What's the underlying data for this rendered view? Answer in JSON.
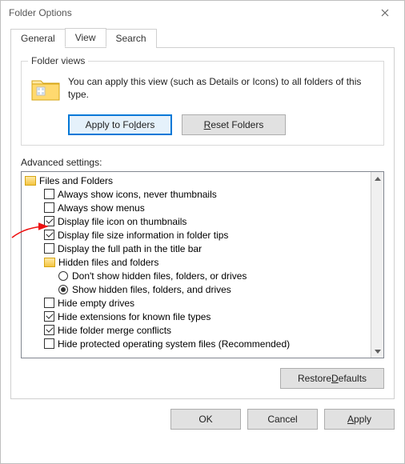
{
  "window": {
    "title": "Folder Options"
  },
  "tabs": {
    "general": "General",
    "view": "View",
    "search": "Search"
  },
  "folderViews": {
    "groupLabel": "Folder views",
    "text": "You can apply this view (such as Details or Icons) to all folders of this type.",
    "applyBtn_pre": "Apply to Fo",
    "applyBtn_u": "l",
    "applyBtn_post": "ders",
    "resetBtn_pre": "",
    "resetBtn_u": "R",
    "resetBtn_post": "eset Folders"
  },
  "advancedLabel": "Advanced settings:",
  "tree": {
    "root": "Files and Folders",
    "i0": "Always show icons, never thumbnails",
    "i1": "Always show menus",
    "i2": "Display file icon on thumbnails",
    "i3": "Display file size information in folder tips",
    "i4": "Display the full path in the title bar",
    "hiddenGroup": "Hidden files and folders",
    "r0": "Don't show hidden files, folders, or drives",
    "r1": "Show hidden files, folders, and drives",
    "i5": "Hide empty drives",
    "i6": "Hide extensions for known file types",
    "i7": "Hide folder merge conflicts",
    "i8": "Hide protected operating system files (Recommended)"
  },
  "restoreBtn_pre": "Restore ",
  "restoreBtn_u": "D",
  "restoreBtn_post": "efaults",
  "buttons": {
    "ok": "OK",
    "cancel": "Cancel",
    "apply_u": "A",
    "apply_post": "pply"
  }
}
